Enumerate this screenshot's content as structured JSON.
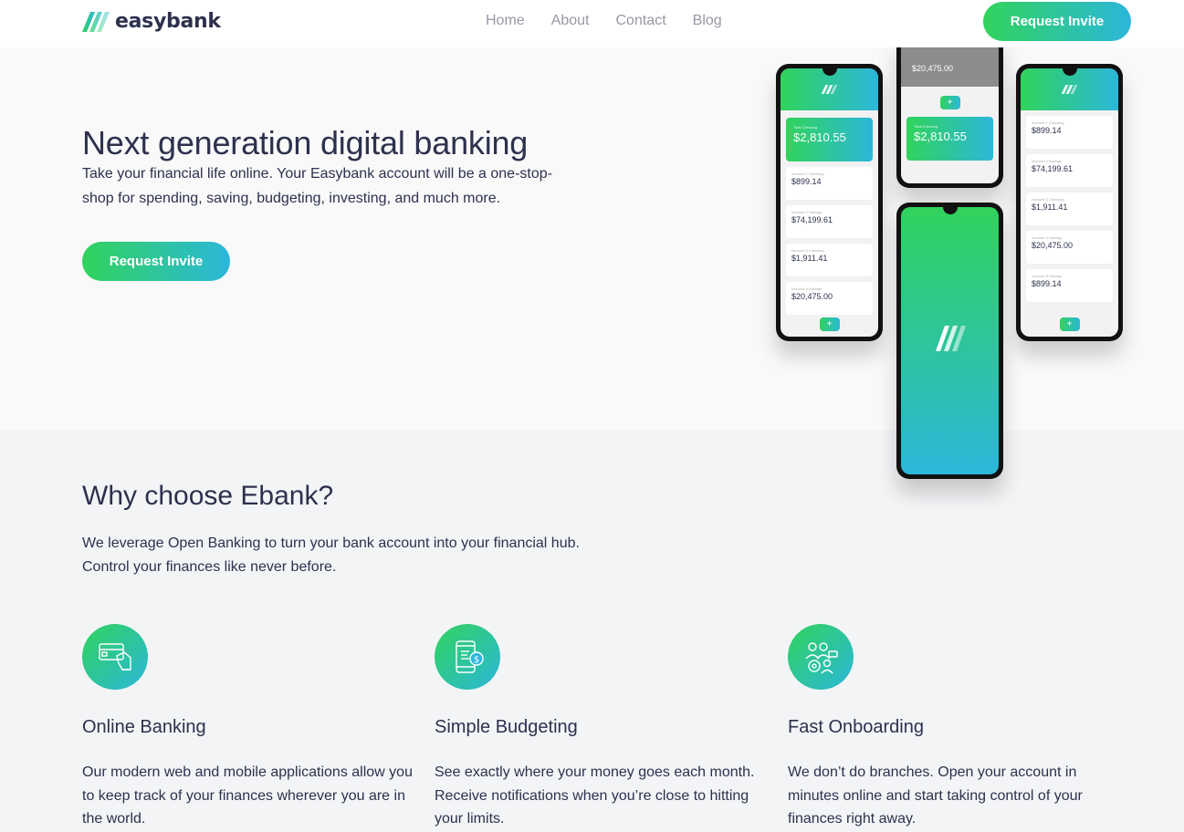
{
  "header": {
    "logo_text": "easybank",
    "nav": [
      "Home",
      "About",
      "Contact",
      "Blog"
    ],
    "cta": "Request Invite"
  },
  "hero": {
    "title": "Next generation digital banking",
    "text": "Take your financial life online. Your Easybank account will be a one-stop-shop for spending, saving, budgeting, investing, and much more.",
    "cta": "Request Invite"
  },
  "phones": {
    "total_value": "$2,810.55",
    "accounts": [
      "$899.14",
      "$74,199.61",
      "$1,911.41",
      "$20,475.00",
      "$899.14"
    ],
    "top_account": "$20,475.00"
  },
  "why": {
    "title": "Why choose Ebank?",
    "text": "We leverage Open Banking to turn your bank account into your financial hub. Control your finances like never before."
  },
  "features": [
    {
      "title": "Online Banking",
      "text": "Our modern web and mobile applications allow you to keep track of your finances wherever you are in the world.",
      "icon": "online-banking-icon"
    },
    {
      "title": "Simple Budgeting",
      "text": "See exactly where your money goes each month. Receive notifications when you’re close to hitting your limits.",
      "icon": "budgeting-icon"
    },
    {
      "title": "Fast Onboarding",
      "text": "We don’t do branches. Open your account in minutes online and start taking control of your finances right away.",
      "icon": "onboarding-icon"
    }
  ],
  "colors": {
    "accent_green": "#31d35c",
    "accent_cyan": "#2bb7da",
    "dark_blue": "#2d314d",
    "nav_gray": "#9698a6",
    "hero_bg": "#f9f9f9",
    "section_bg": "#f3f4f6"
  }
}
